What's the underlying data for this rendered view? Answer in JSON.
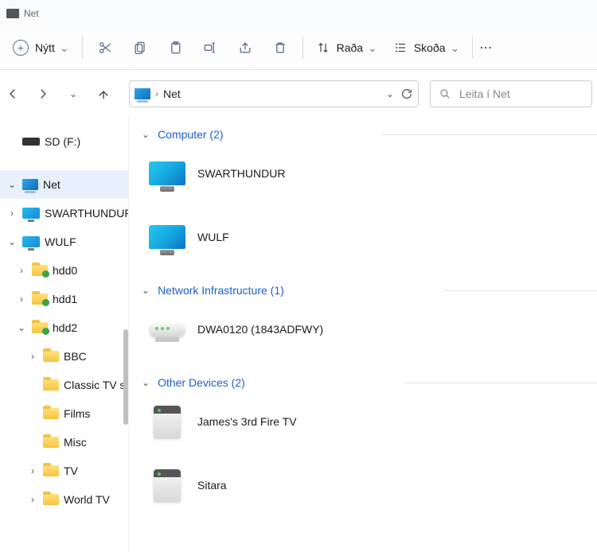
{
  "window": {
    "title": "Net"
  },
  "toolbar": {
    "new_label": "Nýtt",
    "sort_label": "Raða",
    "view_label": "Skoða"
  },
  "address": {
    "location": "Net"
  },
  "search": {
    "placeholder": "Leita í Net"
  },
  "sidebar": {
    "items": [
      {
        "label": "SD (F:)",
        "icon": "sd",
        "indent": 0,
        "toggle": "none"
      },
      {
        "label": "Net",
        "icon": "net",
        "indent": 0,
        "toggle": "open",
        "selected": true
      },
      {
        "label": "SWARTHUNDUR",
        "icon": "monitor",
        "indent": 0,
        "toggle": "closed"
      },
      {
        "label": "WULF",
        "icon": "monitor",
        "indent": 0,
        "toggle": "open"
      },
      {
        "label": "hdd0",
        "icon": "folder-shared",
        "indent": 1,
        "toggle": "closed"
      },
      {
        "label": "hdd1",
        "icon": "folder-shared",
        "indent": 1,
        "toggle": "closed"
      },
      {
        "label": "hdd2",
        "icon": "folder-shared",
        "indent": 1,
        "toggle": "open"
      },
      {
        "label": "BBC",
        "icon": "folder",
        "indent": 2,
        "toggle": "closed"
      },
      {
        "label": "Classic TV series",
        "icon": "folder",
        "indent": 2,
        "toggle": "none"
      },
      {
        "label": "Films",
        "icon": "folder",
        "indent": 2,
        "toggle": "none"
      },
      {
        "label": "Misc",
        "icon": "folder",
        "indent": 2,
        "toggle": "none"
      },
      {
        "label": "TV",
        "icon": "folder",
        "indent": 2,
        "toggle": "closed"
      },
      {
        "label": "World TV",
        "icon": "folder",
        "indent": 2,
        "toggle": "closed"
      }
    ]
  },
  "content": {
    "groups": [
      {
        "title": "Computer (2)",
        "items": [
          {
            "label": "SWARTHUNDUR",
            "kind": "computer"
          },
          {
            "label": "WULF",
            "kind": "computer"
          }
        ]
      },
      {
        "title": "Network Infrastructure (1)",
        "items": [
          {
            "label": "DWA0120 (1843ADFWY)",
            "kind": "router"
          }
        ]
      },
      {
        "title": "Other Devices (2)",
        "items": [
          {
            "label": "James's 3rd Fire TV",
            "kind": "device"
          },
          {
            "label": "Sitara",
            "kind": "device"
          }
        ]
      }
    ]
  }
}
